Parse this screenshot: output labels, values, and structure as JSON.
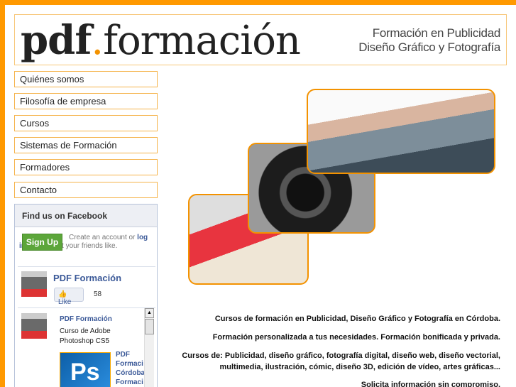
{
  "header": {
    "logo_bold": "pdf",
    "logo_dot": ".",
    "logo_rest": "formación",
    "tagline_1": "Formación en Publicidad",
    "tagline_2": "Diseño Gráfico y Fotografía"
  },
  "nav": [
    "Quiénes somos",
    "Filosofía de empresa",
    "Cursos",
    "Sistemas de Formación",
    "Formadores",
    "Contacto"
  ],
  "facebook": {
    "title": "Find us on Facebook",
    "signup": "Sign Up",
    "create_pre": "Create an account or ",
    "login": "log in",
    "create_post": " to see what your friends like.",
    "page_name": "PDF Formación",
    "like": "Like",
    "like_count": "58",
    "feed_name": "PDF Formación",
    "feed_text": "Curso de Adobe Photoshop CS5",
    "ps_label": "Ps",
    "feed2_lines": [
      "PDF",
      "Formaci",
      "Córdoba",
      "Formaci"
    ]
  },
  "content": {
    "line1": "Cursos de formación en Publicidad, Diseño Gráfico y Fotografía en Córdoba.",
    "line2": "Formación personalizada a tus necesidades. Formación bonificada y privada.",
    "line3a": "Cursos de: Publicidad, diseño gráfico, fotografía digital, diseño web, diseño vectorial,",
    "line3b": "multimedia, ilustración, cómic, diseño 3D, edición de vídeo, artes gráficas...",
    "line4": "Solicita información sin compromiso."
  },
  "colors": {
    "accent": "#ff9900",
    "facebook": "#3b5998"
  }
}
